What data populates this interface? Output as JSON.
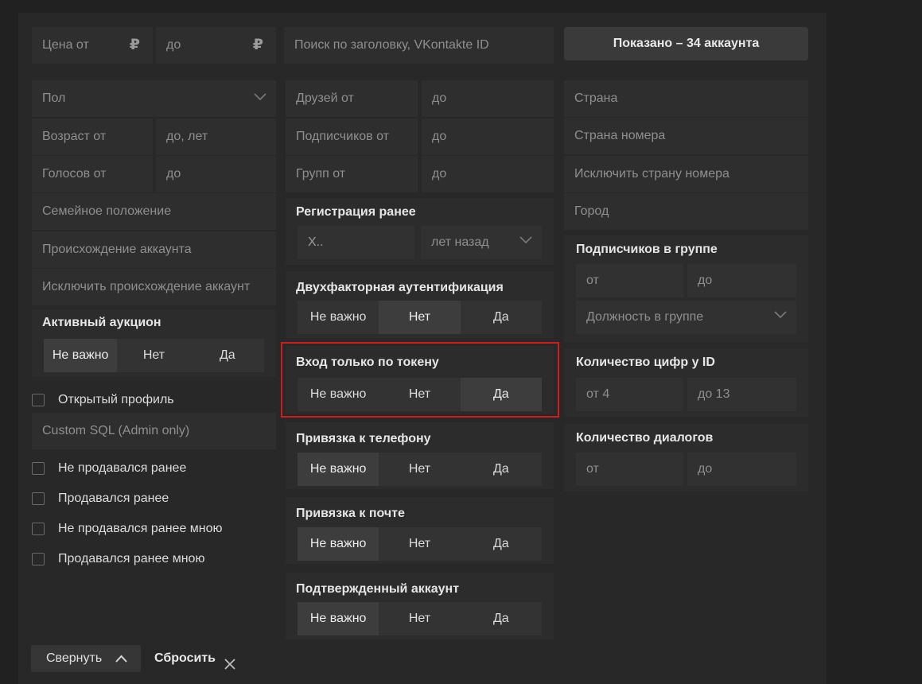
{
  "price": {
    "from_placeholder": "Цена от",
    "to_placeholder": "до",
    "currency": "₽"
  },
  "search": {
    "placeholder": "Поиск по заголовку, VKontakte ID"
  },
  "shown_button": {
    "label": "Показано – 34 аккаунта"
  },
  "left": {
    "gender": "Пол",
    "age_from": "Возраст от",
    "age_to": "до, лет",
    "votes_from": "Голосов от",
    "votes_to": "до",
    "marital": "Семейное положение",
    "origin": "Происхождение аккаунта",
    "exclude_origin": "Исключить происхождение аккаунт",
    "auction": {
      "title": "Активный аукцион",
      "options": [
        "Не важно",
        "Нет",
        "Да"
      ]
    },
    "open_profile": "Открытый профиль",
    "custom_sql": "Custom SQL (Admin only)",
    "checks": [
      "Не продавался ранее",
      "Продавался ранее",
      "Не продавался ранее мною",
      "Продавался ранее мною"
    ]
  },
  "middle": {
    "friends_from": "Друзей от",
    "friends_to": "до",
    "subs_from": "Подписчиков от",
    "subs_to": "до",
    "groups_from": "Групп от",
    "groups_to": "до",
    "registration": {
      "title": "Регистрация ранее",
      "value": "X..",
      "unit": "лет назад"
    },
    "twofa": {
      "title": "Двухфакторная аутентификация",
      "options": [
        "Не важно",
        "Нет",
        "Да"
      ]
    },
    "token": {
      "title": "Вход только по токену",
      "options": [
        "Не важно",
        "Нет",
        "Да"
      ]
    },
    "phone": {
      "title": "Привязка к телефону",
      "options": [
        "Не важно",
        "Нет",
        "Да"
      ]
    },
    "email": {
      "title": "Привязка к почте",
      "options": [
        "Не важно",
        "Нет",
        "Да"
      ]
    },
    "verified": {
      "title": "Подтвержденный аккаунт",
      "options": [
        "Не важно",
        "Нет",
        "Да"
      ]
    }
  },
  "right": {
    "country": "Страна",
    "phone_country": "Страна номера",
    "exclude_phone_country": "Исключить страну номера",
    "city": "Город",
    "group_subs": {
      "title": "Подписчиков в группе",
      "from": "от",
      "to": "до",
      "position": "Должность в группе"
    },
    "id_digits": {
      "title": "Количество цифр у ID",
      "from": "от 4",
      "to": "до 13"
    },
    "dialogs": {
      "title": "Количество диалогов",
      "from": "от",
      "to": "до"
    }
  },
  "footer": {
    "collapse": "Свернуть",
    "reset": "Сбросить"
  }
}
